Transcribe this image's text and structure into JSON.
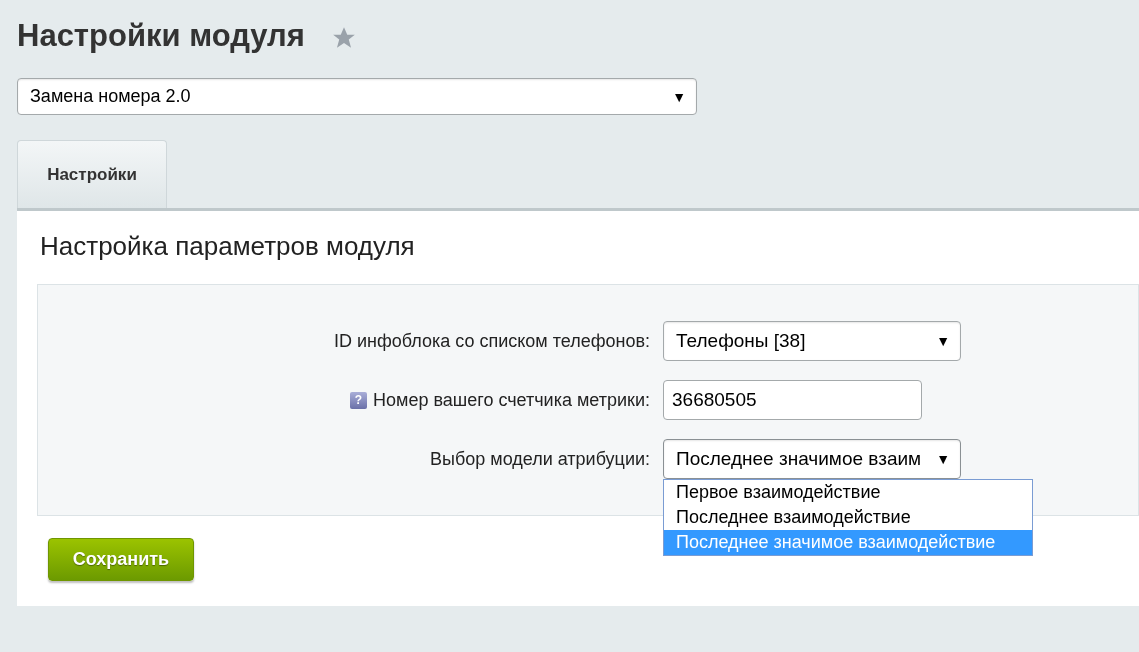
{
  "page_title": "Настройки модуля",
  "module_select": {
    "value": "Замена номера 2.0",
    "arrow": "▼"
  },
  "tabs": [
    {
      "label": "Настройки",
      "selected": true
    }
  ],
  "section_title": "Настройка параметров модуля",
  "fields": [
    {
      "kind": "select",
      "label": "ID инфоблока со списком телефонов:",
      "value": "Телефоны [38]",
      "arrow": "▼"
    },
    {
      "kind": "input",
      "label": "Номер вашего счетчика метрики:",
      "value": "36680505",
      "help_icon": "?"
    },
    {
      "kind": "select",
      "label": "Выбор модели атрибуции:",
      "value": "Последнее значимое взаим",
      "arrow": "▼",
      "open": true,
      "options": [
        {
          "label": "Первое взаимодействие",
          "selected": false
        },
        {
          "label": "Последнее взаимодействие",
          "selected": false
        },
        {
          "label": "Последнее значимое взаимодействие",
          "selected": true
        }
      ]
    }
  ],
  "save_button": "Сохранить"
}
